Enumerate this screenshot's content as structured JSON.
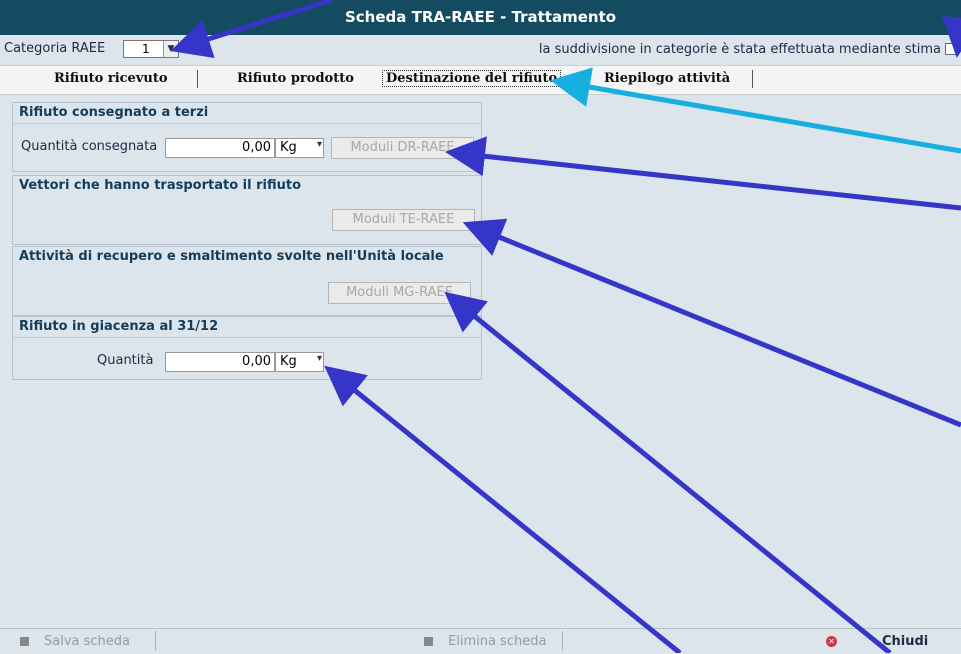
{
  "window": {
    "title": "Scheda TRA-RAEE - Trattamento"
  },
  "top": {
    "categoria_label": "Categoria RAEE",
    "categoria_value": "1",
    "stima_label": "la suddivisione in categorie è stata effettuata mediante stima"
  },
  "tabs": [
    {
      "label": "Rifiuto ricevuto"
    },
    {
      "label": "Rifiuto prodotto"
    },
    {
      "label": "Destinazione del rifiuto"
    },
    {
      "label": "Riepilogo attività"
    }
  ],
  "panels": {
    "terzi": {
      "title": "Rifiuto consegnato a terzi",
      "qty_label": "Quantità consegnata",
      "qty_value": "0,00",
      "unit": "Kg",
      "button": "Moduli DR-RAEE"
    },
    "vettori": {
      "title": "Vettori che hanno trasportato il rifiuto",
      "button": "Moduli TE-RAEE"
    },
    "attivita": {
      "title": "Attività di recupero e smaltimento svolte nell'Unità locale",
      "button": "Moduli MG-RAEE"
    },
    "giacenza": {
      "title": "Rifiuto in giacenza al 31/12",
      "qty_label": "Quantità",
      "qty_value": "0,00",
      "unit": "Kg"
    }
  },
  "footer": {
    "save": "Salva scheda",
    "delete": "Elimina scheda",
    "close": "Chiudi"
  },
  "colors": {
    "titlebar": "#144b60",
    "background": "#dce4ec",
    "arrow_dark": "#3535c8",
    "arrow_light": "#17aee0"
  }
}
